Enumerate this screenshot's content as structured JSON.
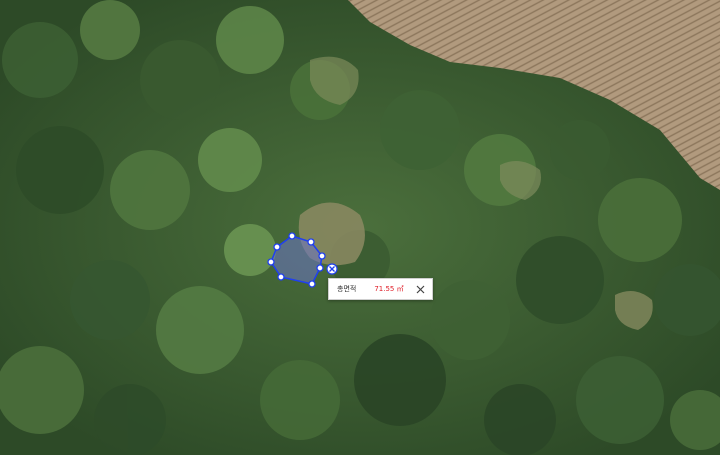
{
  "map": {
    "type": "satellite",
    "icons": {
      "vertex": "polygon-vertex-handle",
      "delete": "delete-x-icon",
      "close": "close-icon"
    },
    "colors": {
      "polygon_stroke": "#1f3ff0",
      "polygon_fill": "#6b74c9",
      "area_value": "#e0202a"
    }
  },
  "measurement": {
    "label": "총면적",
    "value": "71.55 ㎡"
  }
}
